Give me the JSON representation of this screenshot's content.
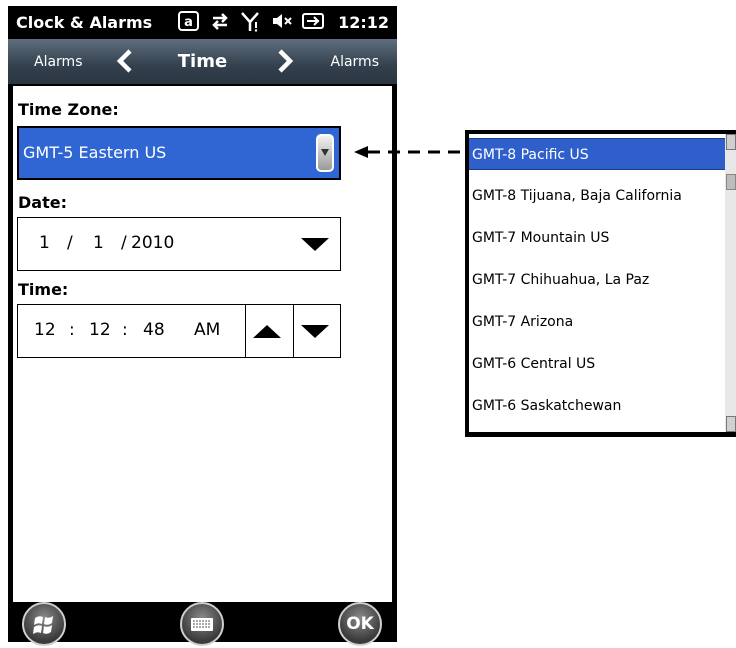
{
  "status_bar": {
    "app_title": "Clock & Alarms",
    "time": "12:12",
    "icons": [
      "at-sign-icon",
      "data-transfer-icon",
      "signal-icon",
      "volume-muted-icon",
      "battery-icon"
    ]
  },
  "nav": {
    "prev_label": "Alarms",
    "title": "Time",
    "next_label": "Alarms"
  },
  "time_zone": {
    "label": "Time Zone:",
    "value": "GMT-5 Eastern US"
  },
  "date": {
    "label": "Date:",
    "month": "1",
    "day": "1",
    "year": "2010",
    "sep1": "/",
    "sep2": "/"
  },
  "time": {
    "label": "Time:",
    "hour": "12",
    "minute": "12",
    "second": "48",
    "ampm": "AM",
    "colon1": ":",
    "colon2": ":"
  },
  "bottom_bar": {
    "ok_label": "OK"
  },
  "timezone_list": {
    "items": [
      "GMT-8 Pacific US",
      "GMT-8 Tijuana, Baja California",
      "GMT-7 Mountain US",
      "GMT-7 Chihuahua, La Paz",
      "GMT-7 Arizona",
      "GMT-6 Central US",
      "GMT-6 Saskatchewan"
    ],
    "selected_index": 0
  },
  "colors": {
    "selection_blue": "#2f66d3",
    "nav_gradient_top": "#5e6e7e",
    "nav_gradient_bottom": "#2a3540"
  }
}
